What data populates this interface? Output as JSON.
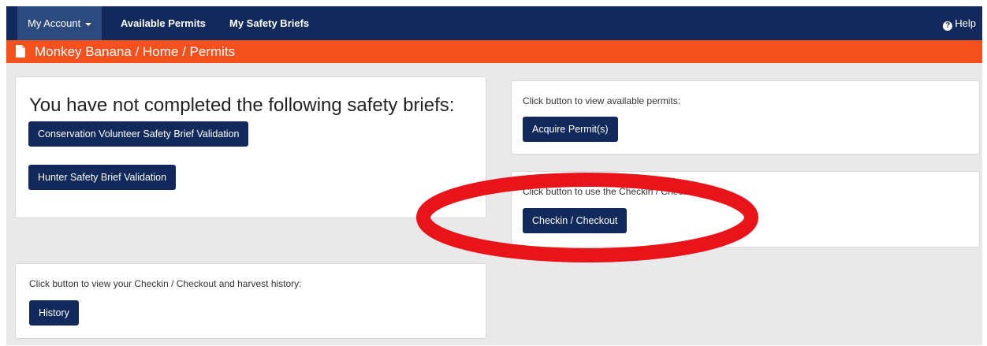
{
  "navbar": {
    "my_account": "My Account",
    "available_permits": "Available Permits",
    "my_safety_briefs": "My Safety Briefs",
    "help": "Help"
  },
  "breadcrumb": {
    "icon": "document-icon",
    "path": "Monkey Banana / Home / Permits"
  },
  "safety_panel": {
    "heading": "You have not completed the following safety briefs:",
    "briefs": [
      "Conservation Volunteer Safety Brief Validation",
      "Hunter Safety Brief Validation"
    ]
  },
  "permits_panel": {
    "text": "Click button to view available permits:",
    "button": "Acquire Permit(s)"
  },
  "checkin_panel": {
    "text": "Click button to use the Checkin / Checkout:",
    "button": "Checkin / Checkout"
  },
  "history_panel": {
    "text": "Click button to view your Checkin / Checkout and harvest history:",
    "button": "History"
  },
  "colors": {
    "navbar": "#112a5b",
    "breadcrumb": "#f4511e",
    "button": "#112a5b",
    "annotation": "#e8141a"
  }
}
